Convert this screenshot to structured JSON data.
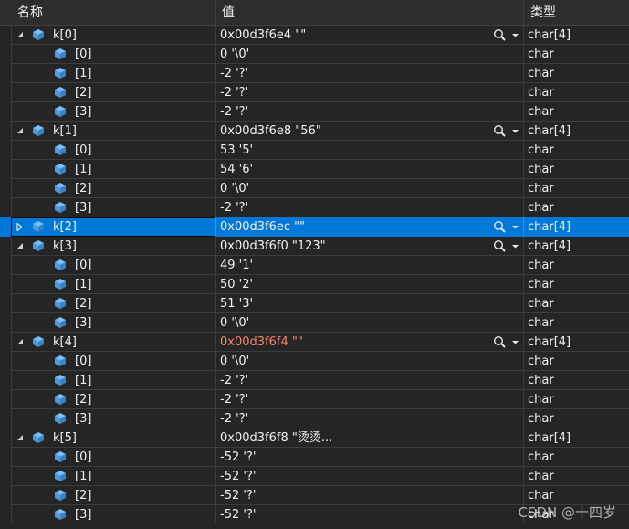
{
  "header": {
    "name": "名称",
    "value": "值",
    "type": "类型"
  },
  "rows": [
    {
      "level": 0,
      "expanded": true,
      "name": "k[0]",
      "value": "0x00d3f6e4 \"\"",
      "type": "char[4]",
      "mag": true
    },
    {
      "level": 1,
      "name": "[0]",
      "value": "0 '\\0'",
      "type": "char"
    },
    {
      "level": 1,
      "name": "[1]",
      "value": "-2 '?'",
      "type": "char"
    },
    {
      "level": 1,
      "name": "[2]",
      "value": "-2 '?'",
      "type": "char"
    },
    {
      "level": 1,
      "name": "[3]",
      "value": "-2 '?'",
      "type": "char"
    },
    {
      "level": 0,
      "expanded": true,
      "name": "k[1]",
      "value": "0x00d3f6e8 \"56\"",
      "type": "char[4]",
      "mag": true
    },
    {
      "level": 1,
      "name": "[0]",
      "value": "53 '5'",
      "type": "char"
    },
    {
      "level": 1,
      "name": "[1]",
      "value": "54 '6'",
      "type": "char"
    },
    {
      "level": 1,
      "name": "[2]",
      "value": "0 '\\0'",
      "type": "char"
    },
    {
      "level": 1,
      "name": "[3]",
      "value": "-2 '?'",
      "type": "char"
    },
    {
      "level": 0,
      "expanded": false,
      "selected": true,
      "name": "k[2]",
      "value": "0x00d3f6ec \"\"",
      "type": "char[4]",
      "mag": true
    },
    {
      "level": 0,
      "expanded": true,
      "name": "k[3]",
      "value": "0x00d3f6f0 \"123\"",
      "type": "char[4]",
      "mag": true
    },
    {
      "level": 1,
      "name": "[0]",
      "value": "49 '1'",
      "type": "char"
    },
    {
      "level": 1,
      "name": "[1]",
      "value": "50 '2'",
      "type": "char"
    },
    {
      "level": 1,
      "name": "[2]",
      "value": "51 '3'",
      "type": "char"
    },
    {
      "level": 1,
      "name": "[3]",
      "value": "0 '\\0'",
      "type": "char"
    },
    {
      "level": 0,
      "expanded": true,
      "name": "k[4]",
      "value": "0x00d3f6f4 \"\"",
      "type": "char[4]",
      "mag": true,
      "changed": true
    },
    {
      "level": 1,
      "name": "[0]",
      "value": "0 '\\0'",
      "type": "char"
    },
    {
      "level": 1,
      "name": "[1]",
      "value": "-2 '?'",
      "type": "char"
    },
    {
      "level": 1,
      "name": "[2]",
      "value": "-2 '?'",
      "type": "char"
    },
    {
      "level": 1,
      "name": "[3]",
      "value": "-2 '?'",
      "type": "char"
    },
    {
      "level": 0,
      "expanded": true,
      "name": "k[5]",
      "value": "0x00d3f6f8 \"烫烫...",
      "type": "char[4]"
    },
    {
      "level": 1,
      "name": "[0]",
      "value": "-52 '?'",
      "type": "char"
    },
    {
      "level": 1,
      "name": "[1]",
      "value": "-52 '?'",
      "type": "char"
    },
    {
      "level": 1,
      "name": "[2]",
      "value": "-52 '?'",
      "type": "char"
    },
    {
      "level": 1,
      "name": "[3]",
      "value": "-52 '?'",
      "type": "char"
    }
  ],
  "watermark": "CSDN @十四岁",
  "colors": {
    "cube": "#75beff",
    "changed": "#f48771",
    "selection": "#0078d7"
  }
}
